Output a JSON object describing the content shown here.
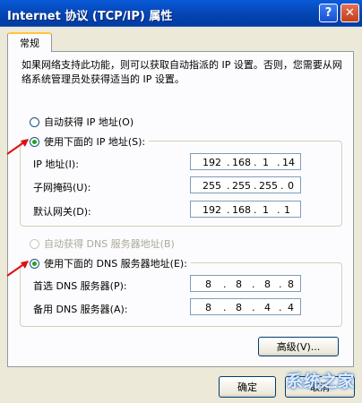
{
  "window": {
    "title": "Internet 协议 (TCP/IP) 属性",
    "help_glyph": "?",
    "close_glyph": "✕"
  },
  "tab": {
    "label": "常规"
  },
  "description": "如果网络支持此功能，则可以获取自动指派的 IP 设置。否则，您需要从网络系统管理员处获得适当的 IP 设置。",
  "ip_section": {
    "auto_label": "自动获得 IP 地址(O)",
    "manual_label": "使用下面的 IP 地址(S):",
    "fields": [
      {
        "label": "IP 地址(I):",
        "octets": [
          "192",
          "168",
          "1",
          "14"
        ]
      },
      {
        "label": "子网掩码(U):",
        "octets": [
          "255",
          "255",
          "255",
          "0"
        ]
      },
      {
        "label": "默认网关(D):",
        "octets": [
          "192",
          "168",
          "1",
          "1"
        ]
      }
    ]
  },
  "dns_section": {
    "auto_label": "自动获得 DNS 服务器地址(B)",
    "manual_label": "使用下面的 DNS 服务器地址(E):",
    "fields": [
      {
        "label": "首选 DNS 服务器(P):",
        "octets": [
          "8",
          "8",
          "8",
          "8"
        ]
      },
      {
        "label": "备用 DNS 服务器(A):",
        "octets": [
          "8",
          "8",
          "4",
          "4"
        ]
      }
    ]
  },
  "buttons": {
    "advanced": "高级(V)...",
    "ok": "确定",
    "cancel": "取消"
  },
  "watermark": "系统之家",
  "colors": {
    "titlebar": "#0547b8",
    "radio_check": "#21a121",
    "arrow": "#e01010"
  }
}
